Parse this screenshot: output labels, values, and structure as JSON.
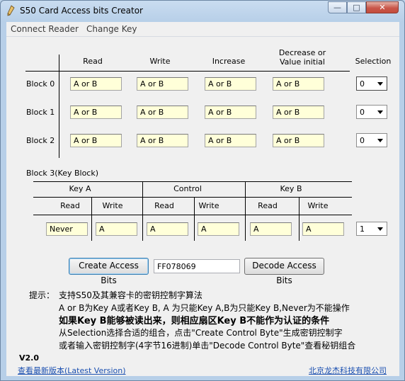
{
  "window": {
    "title": "S50 Card Access bits Creator",
    "minimize": "—",
    "maximize": "□",
    "close": "✕"
  },
  "menu": [
    "Connect Reader",
    "Change Key"
  ],
  "top_table": {
    "headers": [
      "Read",
      "Write",
      "Increase",
      "Decrease or\nValue initial"
    ],
    "selection_header": "Selection",
    "rows": [
      {
        "label": "Block 0",
        "cells": [
          "A or B",
          "A or B",
          "A or B",
          "A or B"
        ],
        "selection": "0"
      },
      {
        "label": "Block 1",
        "cells": [
          "A or B",
          "A or B",
          "A or B",
          "A or B"
        ],
        "selection": "0"
      },
      {
        "label": "Block 2",
        "cells": [
          "A or B",
          "A or B",
          "A or B",
          "A or B"
        ],
        "selection": "0"
      }
    ]
  },
  "block3": {
    "label": "Block 3(Key Block)",
    "groups": [
      "Key A",
      "Control",
      "Key B"
    ],
    "subheaders": [
      "Read",
      "Write",
      "Read",
      "Write",
      "Read",
      "Write"
    ],
    "cells": [
      "Never",
      "A",
      "A",
      "A",
      "A",
      "A"
    ],
    "selection": "1"
  },
  "actions": {
    "create_label": "Create Access Bits",
    "code_value": "FF078069",
    "decode_label": "Decode Access Bits"
  },
  "tips": {
    "heading": "提示：",
    "lines": [
      "支持S50及其兼容卡的密钥控制字算法",
      "A or B为Key A或者Key B, A 为只能Key A,B为只能Key B,Never为不能操作",
      "如果Key B能够被读出来，则相应扇区Key B不能作为认证的条件",
      "从Selection选择合适的组合，点击\"Create Control Byte\"生成密钥控制字",
      "或者输入密钥控制字(4字节16进制)单击\"Decode Control Byte\"查看秘钥组合"
    ]
  },
  "footer": {
    "version": "V2.0",
    "latest_link": "查看最新版本(Latest Version)",
    "company_link": "北京龙杰科技有限公司"
  }
}
